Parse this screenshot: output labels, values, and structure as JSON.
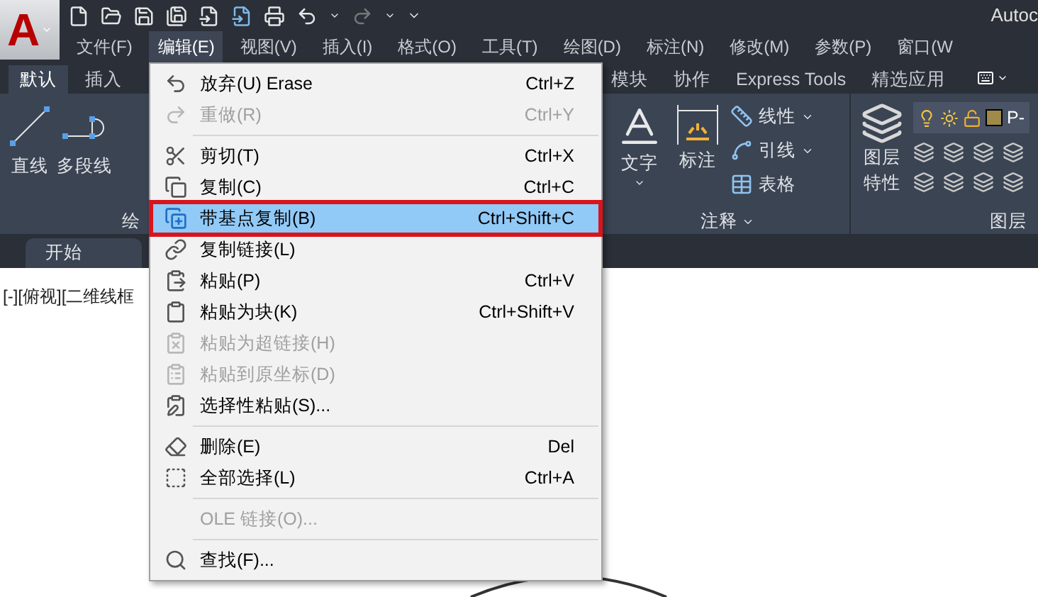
{
  "app_button": {
    "logo": "A"
  },
  "title_bar": {
    "title": "Autoc"
  },
  "menu_bar": [
    {
      "label": "文件(F)",
      "selected": false
    },
    {
      "label": "编辑(E)",
      "selected": true
    },
    {
      "label": "视图(V)",
      "selected": false
    },
    {
      "label": "插入(I)",
      "selected": false
    },
    {
      "label": "格式(O)",
      "selected": false
    },
    {
      "label": "工具(T)",
      "selected": false
    },
    {
      "label": "绘图(D)",
      "selected": false
    },
    {
      "label": "标注(N)",
      "selected": false
    },
    {
      "label": "修改(M)",
      "selected": false
    },
    {
      "label": "参数(P)",
      "selected": false
    },
    {
      "label": "窗口(W",
      "selected": false
    }
  ],
  "ribbon_tabs": [
    {
      "label": "默认",
      "selected": true
    },
    {
      "label": "插入",
      "selected": false
    }
  ],
  "ribbon_tabs_right": [
    {
      "label": "模块",
      "selected": false
    },
    {
      "label": "协作",
      "selected": false
    },
    {
      "label": "Express Tools",
      "selected": false
    },
    {
      "label": "精选应用",
      "selected": false
    }
  ],
  "draw_panel": {
    "label": "绘",
    "tools": [
      {
        "kind": "line",
        "label": "直线"
      },
      {
        "kind": "polyline",
        "label": "多段线"
      }
    ]
  },
  "annotation_panel": {
    "label": "注释",
    "text_tool": "文字",
    "dimension_tool": "标注",
    "small_tools": [
      {
        "kind": "linear",
        "label": "线性",
        "dropdown": true
      },
      {
        "kind": "leader",
        "label": "引线",
        "dropdown": true
      },
      {
        "kind": "table",
        "label": "表格",
        "dropdown": false
      }
    ]
  },
  "layer_panel": {
    "label": "图层",
    "properties_tool": [
      "图层",
      "特性"
    ],
    "current_layer": "P-"
  },
  "file_tabs": [
    {
      "label": "开始",
      "selected": true
    }
  ],
  "viewport": {
    "label": "[-][俯视][二维线框"
  },
  "edit_menu": [
    {
      "kind": "item",
      "label": "放弃(U) Erase",
      "shortcut": "Ctrl+Z",
      "disabled": false,
      "selected": false
    },
    {
      "kind": "item",
      "label": "重做(R)",
      "shortcut": "Ctrl+Y",
      "disabled": true,
      "selected": false
    },
    {
      "kind": "separator"
    },
    {
      "kind": "item",
      "label": "剪切(T)",
      "shortcut": "Ctrl+X",
      "disabled": false,
      "selected": false
    },
    {
      "kind": "item",
      "label": "复制(C)",
      "shortcut": "Ctrl+C",
      "disabled": false,
      "selected": false
    },
    {
      "kind": "item",
      "label": "带基点复制(B)",
      "shortcut": "Ctrl+Shift+C",
      "disabled": false,
      "selected": true
    },
    {
      "kind": "item",
      "label": "复制链接(L)",
      "disabled": false,
      "selected": false
    },
    {
      "kind": "item",
      "label": "粘贴(P)",
      "shortcut": "Ctrl+V",
      "disabled": false,
      "selected": false
    },
    {
      "kind": "item",
      "label": "粘贴为块(K)",
      "shortcut": "Ctrl+Shift+V",
      "disabled": false,
      "selected": false
    },
    {
      "kind": "item",
      "label": "粘贴为超链接(H)",
      "disabled": true,
      "selected": false
    },
    {
      "kind": "item",
      "label": "粘贴到原坐标(D)",
      "disabled": true,
      "selected": false
    },
    {
      "kind": "item",
      "label": "选择性粘贴(S)...",
      "disabled": false,
      "selected": false
    },
    {
      "kind": "separator"
    },
    {
      "kind": "item",
      "label": "删除(E)",
      "shortcut": "Del",
      "disabled": false,
      "selected": false
    },
    {
      "kind": "item",
      "label": "全部选择(L)",
      "shortcut": "Ctrl+A",
      "disabled": false,
      "selected": false
    },
    {
      "kind": "separator"
    },
    {
      "kind": "item",
      "label": "OLE 链接(O)...",
      "disabled": true,
      "selected": false
    },
    {
      "kind": "separator"
    },
    {
      "kind": "item",
      "label": "查找(F)...",
      "disabled": false,
      "selected": false
    }
  ]
}
